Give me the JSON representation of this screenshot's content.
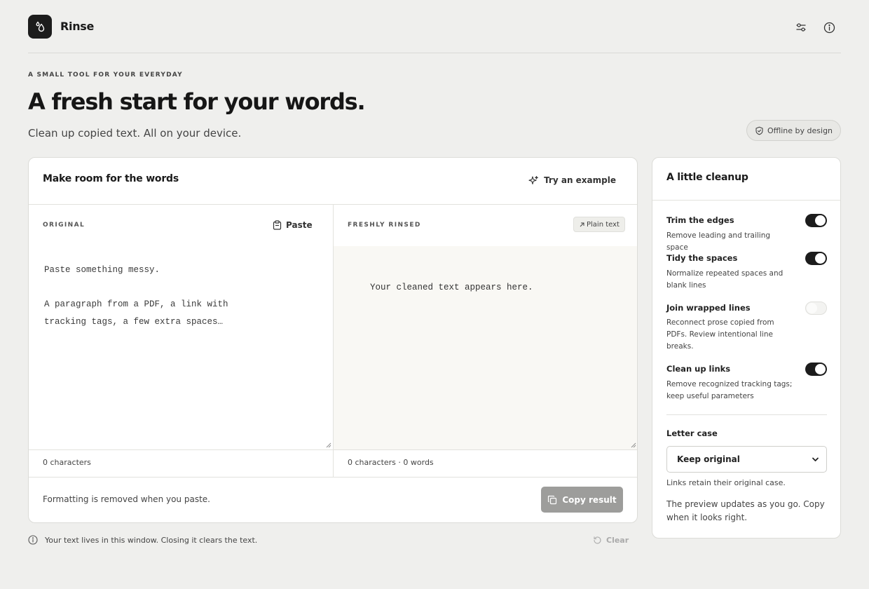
{
  "app": {
    "name": "Rinse"
  },
  "header": {
    "settings_icon": "sliders-icon",
    "info_icon": "info-icon"
  },
  "hero": {
    "eyebrow": "A SMALL TOOL FOR YOUR EVERYDAY",
    "title": "A fresh start for your words.",
    "subtitle": "Clean up copied text. All on your device.",
    "badge": "Offline by design"
  },
  "editor": {
    "title": "Make room for the words",
    "try_example": "Try an example",
    "original_label": "ORIGINAL",
    "paste_label": "Paste",
    "original_placeholder": "Paste something messy.\n\nA paragraph from a PDF, a link with\ntracking tags, a few extra spaces…",
    "result_label": "FRESHLY RINSED",
    "plain_text_badge": "Plain text",
    "result_placeholder": "Your cleaned text appears here.",
    "original_count": "0 characters",
    "result_count": "0 characters · 0 words",
    "footer_note": "Formatting is removed when you paste.",
    "copy_label": "Copy result"
  },
  "below": {
    "note": "Your text lives in this window. Closing it clears the text.",
    "clear_label": "Clear"
  },
  "cleanup": {
    "title": "A little cleanup",
    "options": [
      {
        "title": "Trim the edges",
        "desc": "Remove leading and trailing space",
        "enabled": true
      },
      {
        "title": "Tidy the spaces",
        "desc": "Normalize repeated spaces and blank lines",
        "enabled": true
      },
      {
        "title": "Join wrapped lines",
        "desc": "Reconnect prose copied from PDFs. Review intentional line breaks.",
        "enabled": false
      },
      {
        "title": "Clean up links",
        "desc": "Remove recognized tracking tags; keep useful parameters",
        "enabled": true
      }
    ],
    "letter_case_label": "Letter case",
    "letter_case_value": "Keep original",
    "letter_case_note": "Links retain their original case.",
    "preview_note": "The preview updates as you go. Copy when it looks right."
  }
}
